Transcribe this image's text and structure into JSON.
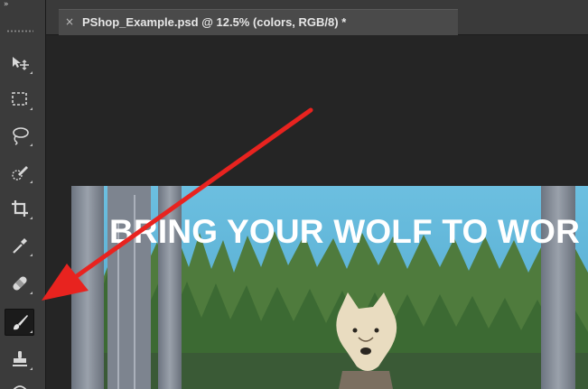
{
  "toolbar": {
    "collapse_glyph": "»",
    "tools": [
      {
        "name": "move-tool",
        "icon": "move-icon"
      },
      {
        "name": "marquee-tool",
        "icon": "rectangular-marquee-icon"
      },
      {
        "name": "lasso-tool",
        "icon": "lasso-icon"
      },
      {
        "name": "quick-selection-tool",
        "icon": "quick-selection-icon"
      },
      {
        "name": "crop-tool",
        "icon": "crop-icon"
      },
      {
        "name": "eyedropper-tool",
        "icon": "eyedropper-icon"
      },
      {
        "name": "spot-healing-tool",
        "icon": "bandage-icon"
      },
      {
        "name": "brush-tool",
        "icon": "brush-icon",
        "selected": true
      },
      {
        "name": "clone-stamp-tool",
        "icon": "stamp-icon"
      },
      {
        "name": "history-brush-tool",
        "icon": "history-brush-icon"
      }
    ]
  },
  "tab": {
    "close_glyph": "×",
    "title": "PShop_Example.psd @ 12.5% (colors, RGB/8) *"
  },
  "canvas": {
    "headline": "BRING YOUR WOLF TO WOR"
  },
  "colors": {
    "annotation_arrow": "#e8231f",
    "sky": "#5fb3d6",
    "trees": "#3f6b34",
    "ui_dark": "#262626"
  }
}
